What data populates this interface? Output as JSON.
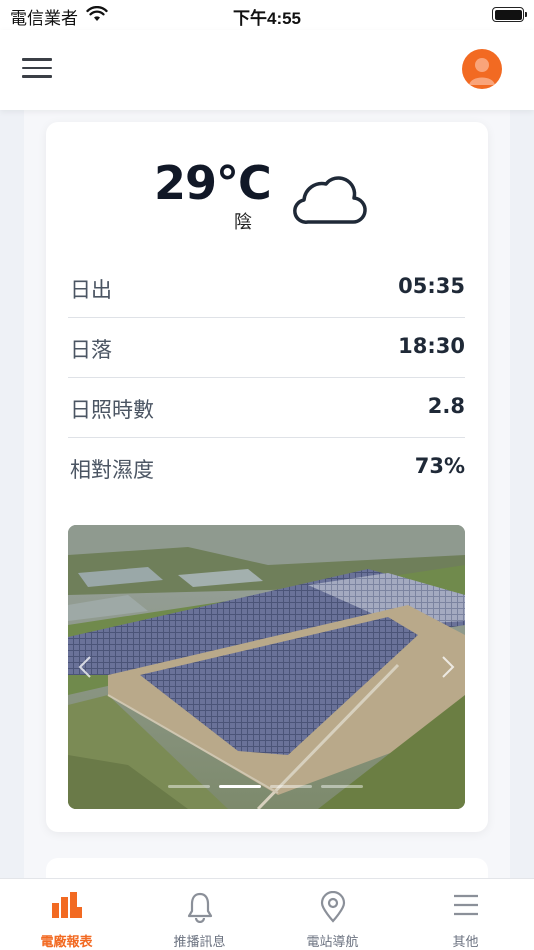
{
  "status_bar": {
    "carrier": "電信業者",
    "time": "下午4:55"
  },
  "colors": {
    "accent": "#f26a22",
    "inactive_tab": "#6b7280",
    "background": "#eef1f6"
  },
  "header": {
    "menu_icon": "hamburger-menu-icon",
    "avatar_icon": "user-avatar-icon"
  },
  "weather": {
    "temperature": "29°C",
    "condition": "陰",
    "icon": "cloud-icon"
  },
  "info_rows": [
    {
      "label": "日出",
      "value": "05:35"
    },
    {
      "label": "日落",
      "value": "18:30"
    },
    {
      "label": "日照時數",
      "value": "2.8"
    },
    {
      "label": "相對濕度",
      "value": "73%"
    }
  ],
  "carousel": {
    "slide_count": 4,
    "active_index": 1
  },
  "tabs": [
    {
      "label": "電廠報表",
      "icon": "bar-chart-icon",
      "active": true
    },
    {
      "label": "推播訊息",
      "icon": "bell-icon",
      "active": false
    },
    {
      "label": "電站導航",
      "icon": "map-pin-icon",
      "active": false
    },
    {
      "label": "其他",
      "icon": "menu-lines-icon",
      "active": false
    }
  ]
}
